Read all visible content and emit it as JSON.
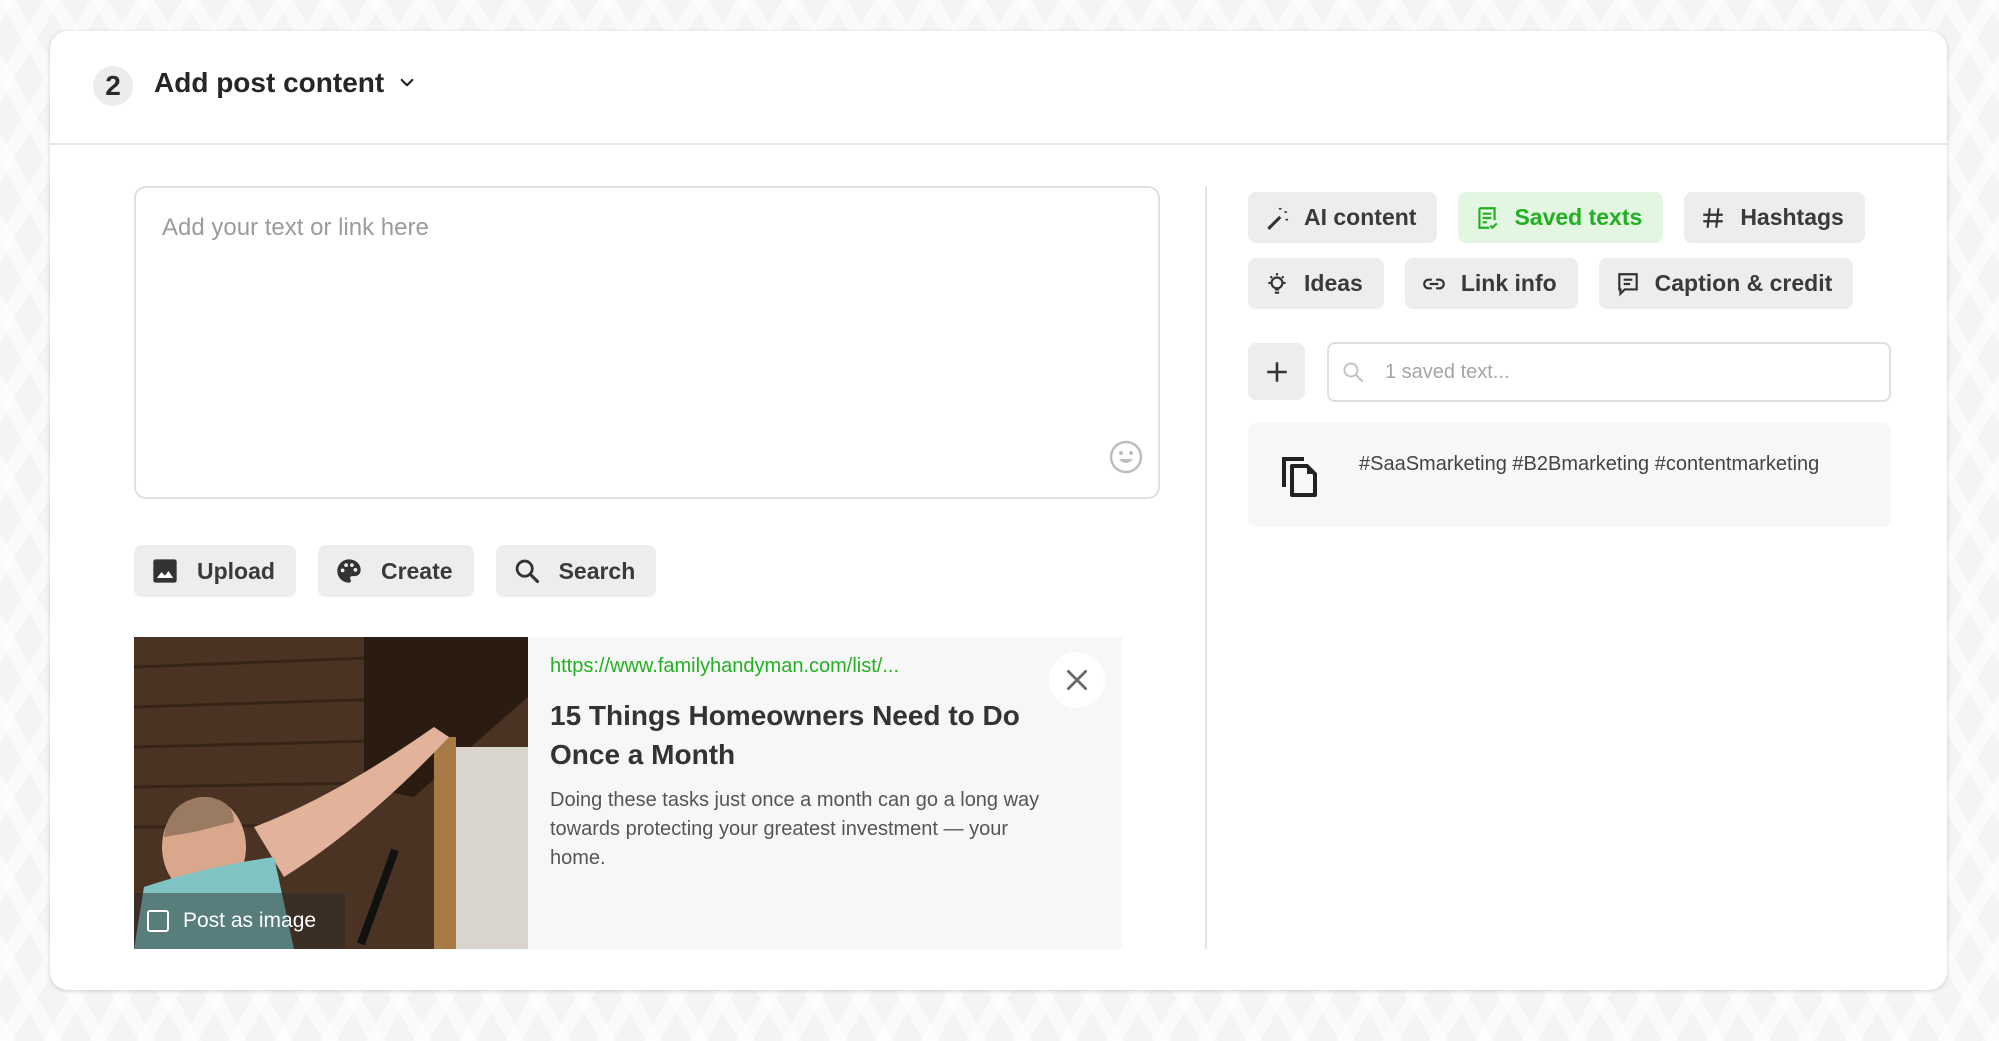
{
  "section": {
    "step_number": "2",
    "title": "Add post content"
  },
  "composer": {
    "placeholder": "Add your text or link here"
  },
  "media_buttons": [
    {
      "label": "Upload",
      "icon": "image-icon"
    },
    {
      "label": "Create",
      "icon": "palette-icon"
    },
    {
      "label": "Search",
      "icon": "search-icon"
    }
  ],
  "link_preview": {
    "url": "https://www.familyhandyman.com/list/...",
    "title": "15 Things Homeowners Need to Do Once a Month",
    "description": "Doing these tasks just once a month can go a long way towards protecting your greatest investment — your home.",
    "post_as_image_label": "Post as image",
    "post_as_image_checked": false
  },
  "tools": {
    "row1": [
      {
        "label": "AI content",
        "icon": "magic-wand-icon",
        "active": false
      },
      {
        "label": "Saved texts",
        "icon": "saved-texts-icon",
        "active": true
      },
      {
        "label": "Hashtags",
        "icon": "hashtag-icon",
        "active": false
      }
    ],
    "row2": [
      {
        "label": "Ideas",
        "icon": "lightbulb-icon",
        "active": false
      },
      {
        "label": "Link info",
        "icon": "link-icon",
        "active": false
      },
      {
        "label": "Caption & credit",
        "icon": "caption-icon",
        "active": false
      }
    ]
  },
  "saved_texts": {
    "search_placeholder": "1 saved text...",
    "items": [
      {
        "text": "#SaaSmarketing #B2Bmarketing #contentmarketing"
      }
    ]
  },
  "colors": {
    "accent_green": "#22b022",
    "active_bg": "#e2f6e2",
    "button_bg": "#ededed"
  }
}
